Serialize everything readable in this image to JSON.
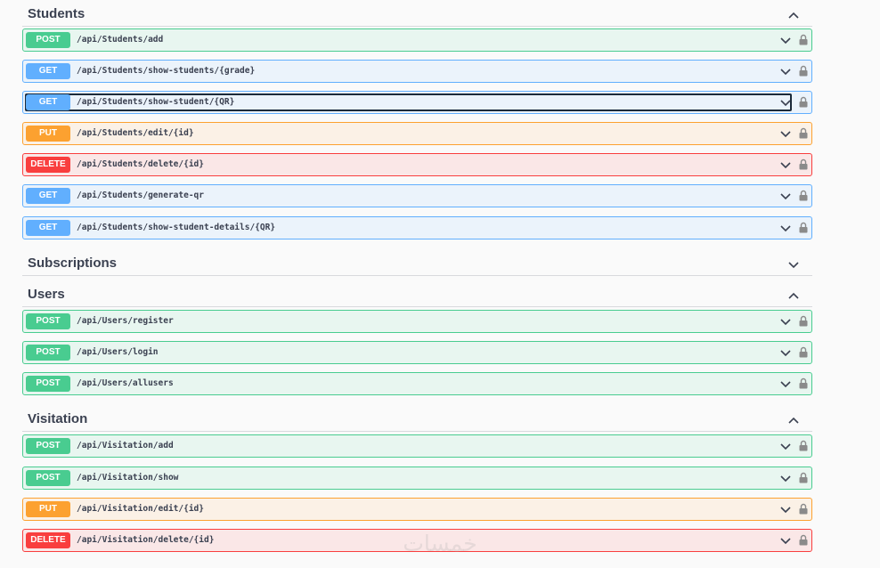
{
  "sections": [
    {
      "title": "Students",
      "expanded": true,
      "operations": [
        {
          "method": "POST",
          "path": "/api/Students/add"
        },
        {
          "method": "GET",
          "path": "/api/Students/show-students/{grade}"
        },
        {
          "method": "GET",
          "path": "/api/Students/show-student/{QR}"
        },
        {
          "method": "PUT",
          "path": "/api/Students/edit/{id}"
        },
        {
          "method": "DELETE",
          "path": "/api/Students/delete/{id}"
        },
        {
          "method": "GET",
          "path": "/api/Students/generate-qr"
        },
        {
          "method": "GET",
          "path": "/api/Students/show-student-details/{QR}"
        }
      ]
    },
    {
      "title": "Subscriptions",
      "expanded": false,
      "operations": []
    },
    {
      "title": "Users",
      "expanded": true,
      "operations": [
        {
          "method": "POST",
          "path": "/api/Users/register"
        },
        {
          "method": "POST",
          "path": "/api/Users/login"
        },
        {
          "method": "POST",
          "path": "/api/Users/allusers"
        }
      ]
    },
    {
      "title": "Visitation",
      "expanded": true,
      "operations": [
        {
          "method": "POST",
          "path": "/api/Visitation/add"
        },
        {
          "method": "POST",
          "path": "/api/Visitation/show"
        },
        {
          "method": "PUT",
          "path": "/api/Visitation/edit/{id}"
        },
        {
          "method": "DELETE",
          "path": "/api/Visitation/delete/{id}"
        }
      ]
    }
  ],
  "watermark": "خمسات",
  "colors": {
    "post": "#49cc90",
    "get": "#61affe",
    "put": "#fca130",
    "delete": "#f93e3e"
  },
  "icons": {
    "expand": "chevron-down-icon",
    "collapse": "chevron-up-icon",
    "auth": "lock-icon"
  }
}
